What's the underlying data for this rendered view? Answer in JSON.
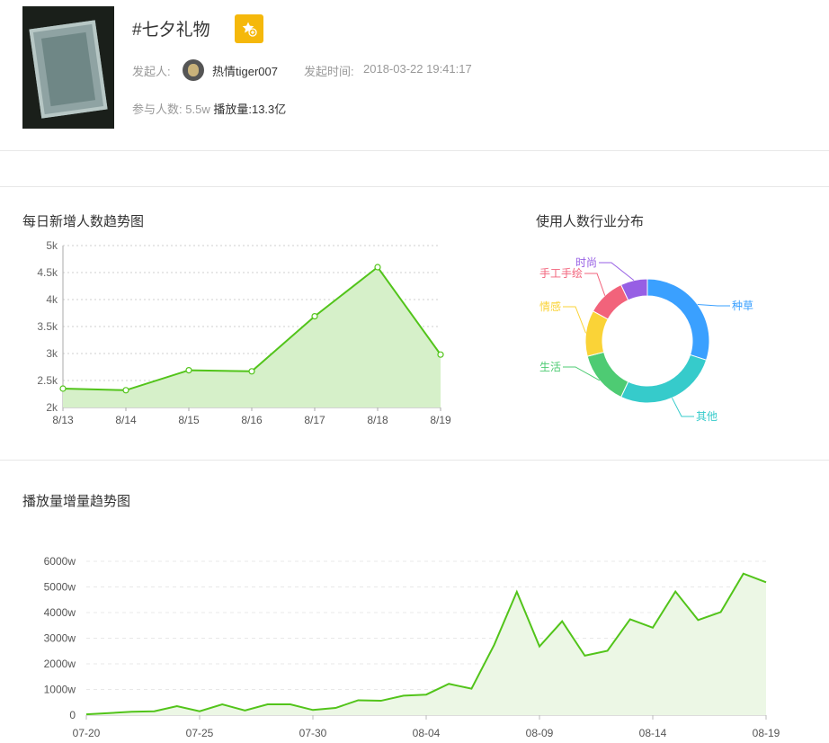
{
  "topic": {
    "title": "#七夕礼物",
    "initiator_label": "发起人:",
    "initiator_name": "热情tiger007",
    "start_time_label": "发起时间:",
    "start_time": "2018-03-22 19:41:17",
    "participants_label": "参与人数:",
    "participants": "5.5w",
    "plays_label": "播放量:",
    "plays": "13.3亿",
    "fav_icon": "star-add-icon",
    "accent": "#f5b80b"
  },
  "chart_data": [
    {
      "type": "area",
      "title": "每日新增人数趋势图",
      "categories": [
        "8/13",
        "8/14",
        "8/15",
        "8/16",
        "8/17",
        "8/18",
        "8/19"
      ],
      "values": [
        2350,
        2320,
        2690,
        2670,
        3690,
        4600,
        2980
      ],
      "yticks": [
        "2k",
        "2.5k",
        "3k",
        "3.5k",
        "4k",
        "4.5k",
        "5k"
      ],
      "ylim": [
        2000,
        5000
      ],
      "color": "#52c41a",
      "grid": true
    },
    {
      "type": "pie",
      "title": "使用人数行业分布",
      "donut": true,
      "slices": [
        {
          "label": "种草",
          "value": 30,
          "color": "#3aa0ff"
        },
        {
          "label": "其他",
          "value": 27,
          "color": "#36cbcb"
        },
        {
          "label": "生活",
          "value": 14,
          "color": "#4ecb73"
        },
        {
          "label": "情感",
          "value": 12,
          "color": "#fad337"
        },
        {
          "label": "手工手绘",
          "value": 10,
          "color": "#f2637b"
        },
        {
          "label": "时尚",
          "value": 7,
          "color": "#975fe4"
        }
      ]
    },
    {
      "type": "area",
      "title": "播放量增量趋势图",
      "xticks": [
        "07-20",
        "07-25",
        "07-30",
        "08-04",
        "08-09",
        "08-14",
        "08-19"
      ],
      "yticks": [
        "0",
        "1000w",
        "2000w",
        "3000w",
        "4000w",
        "5000w",
        "6000w"
      ],
      "ylim": [
        0,
        6000
      ],
      "values": [
        30,
        80,
        130,
        150,
        350,
        150,
        420,
        180,
        420,
        420,
        200,
        280,
        580,
        560,
        760,
        800,
        1220,
        1030,
        2740,
        4810,
        2680,
        3660,
        2320,
        2510,
        3740,
        3410,
        4820,
        3710,
        4020,
        5520,
        5180
      ],
      "color": "#52c41a",
      "grid": true
    }
  ]
}
